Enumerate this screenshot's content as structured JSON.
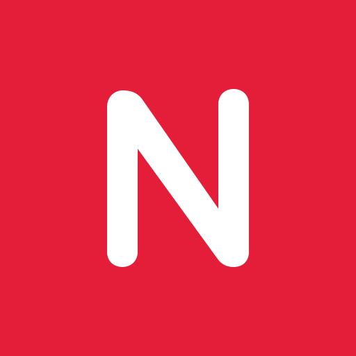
{
  "logo": {
    "letter": "N"
  },
  "colors": {
    "background": "#e41e38",
    "glyph": "#ffffff"
  },
  "icons": [
    "n-logo-icon"
  ]
}
